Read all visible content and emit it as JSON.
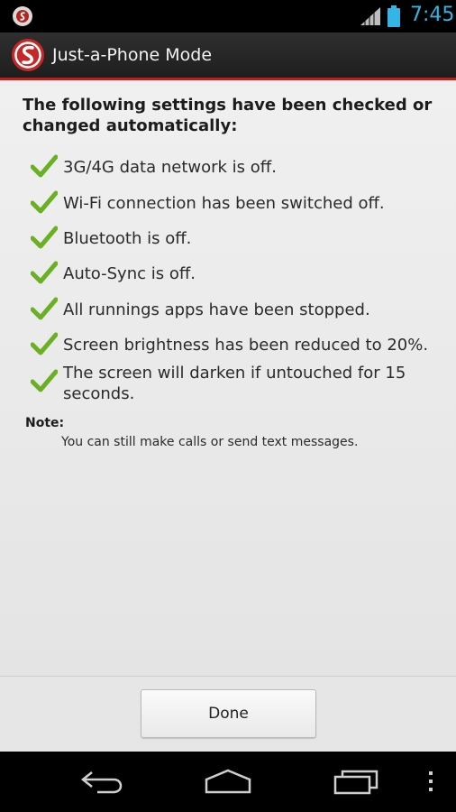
{
  "status_bar": {
    "time": "7:45",
    "icons": [
      "app-notification-icon",
      "signal-icon",
      "battery-icon"
    ],
    "accent_color": "#33b5e5"
  },
  "action_bar": {
    "title": "Just-a-Phone Mode",
    "accent_color": "#c41a1a"
  },
  "main": {
    "heading": "The following settings have been checked or changed automatically:",
    "items": [
      "3G/4G data network is off.",
      "Wi-Fi connection has been switched off.",
      "Bluetooth is off.",
      "Auto-Sync is off.",
      "All runnings apps have been stopped.",
      "Screen brightness has been reduced to 20%.",
      "The screen will darken if untouched for 15 seconds."
    ],
    "item_icon": "checkmark-icon",
    "check_color": "#6ab023",
    "note_label": "Note:",
    "note_text": "You can still make calls or send text messages."
  },
  "footer": {
    "done_label": "Done"
  },
  "nav_bar": {
    "buttons": [
      "back-icon",
      "home-icon",
      "recent-apps-icon",
      "overflow-menu-icon"
    ]
  }
}
